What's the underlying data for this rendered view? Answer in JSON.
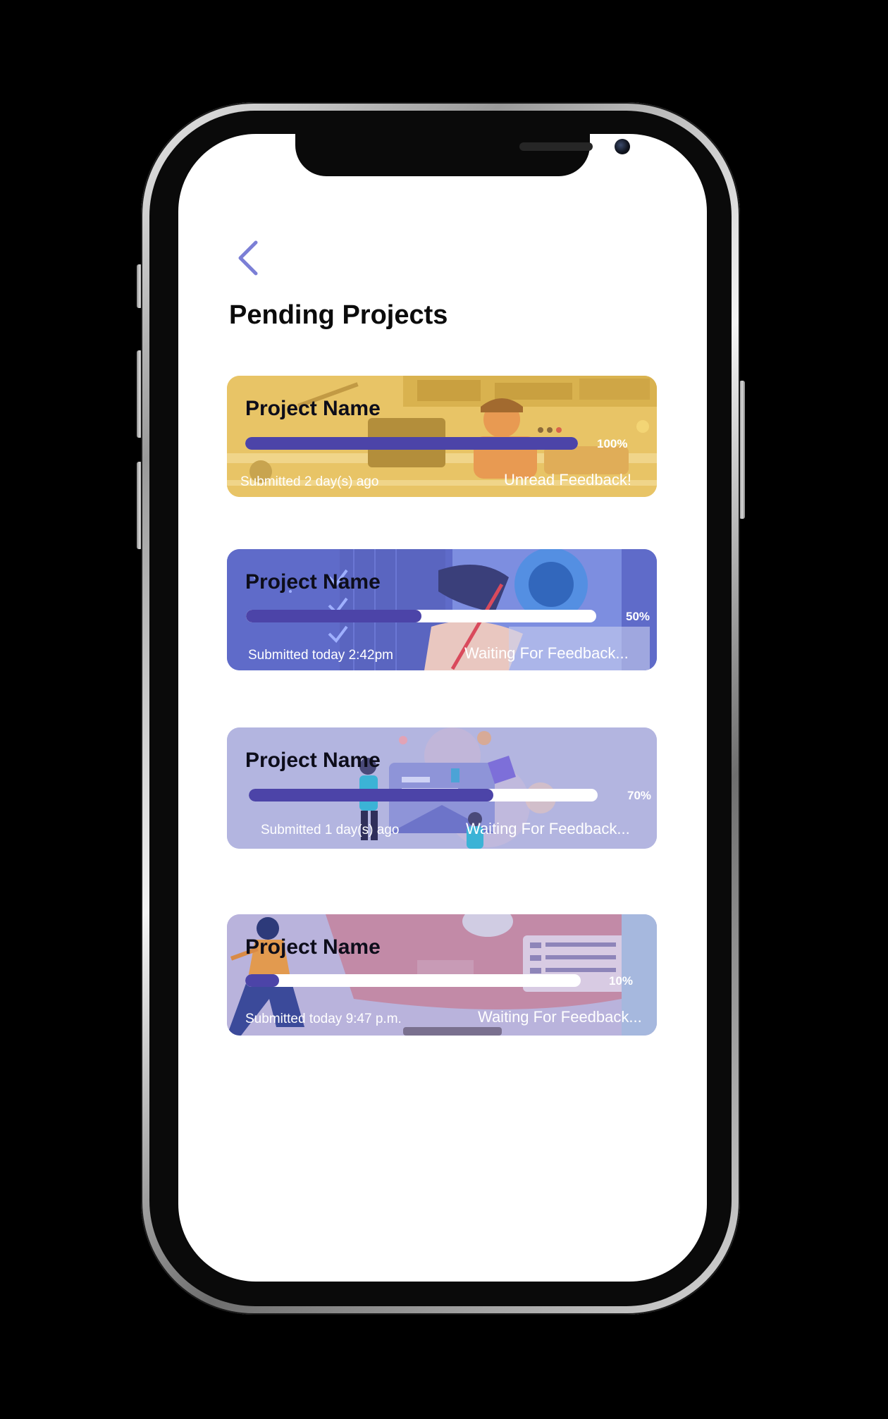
{
  "page": {
    "title": "Pending Projects",
    "back_icon": "chevron-left-icon"
  },
  "colors": {
    "background": "#000000",
    "screen": "#ffffff",
    "accent": "#4c44a8",
    "back_icon": "#7b7fd6"
  },
  "projects": [
    {
      "name": "Project Name",
      "progress": 1.0,
      "progress_label": "100%",
      "submitted": "Submitted 2 day(s) ago",
      "status": "Unread Feedback!",
      "theme": "yellow",
      "card_color": "#e8c466"
    },
    {
      "name": "Project Name",
      "progress": 0.5,
      "progress_label": "50%",
      "submitted": "Submitted today 2:42pm",
      "status": "Waiting For Feedback...",
      "theme": "blue",
      "card_color": "#5f6bc9"
    },
    {
      "name": "Project Name",
      "progress": 0.7,
      "progress_label": "70%",
      "submitted": "Submitted 1 day(s) ago",
      "status": "Waiting For Feedback...",
      "theme": "lavender",
      "card_color": "#b3b5e0"
    },
    {
      "name": "Project Name",
      "progress": 0.1,
      "progress_label": "10%",
      "submitted": "Submitted today 9:47 p.m.",
      "status": "Waiting For Feedback...",
      "theme": "pink",
      "card_color": "#b9b3dc"
    }
  ]
}
